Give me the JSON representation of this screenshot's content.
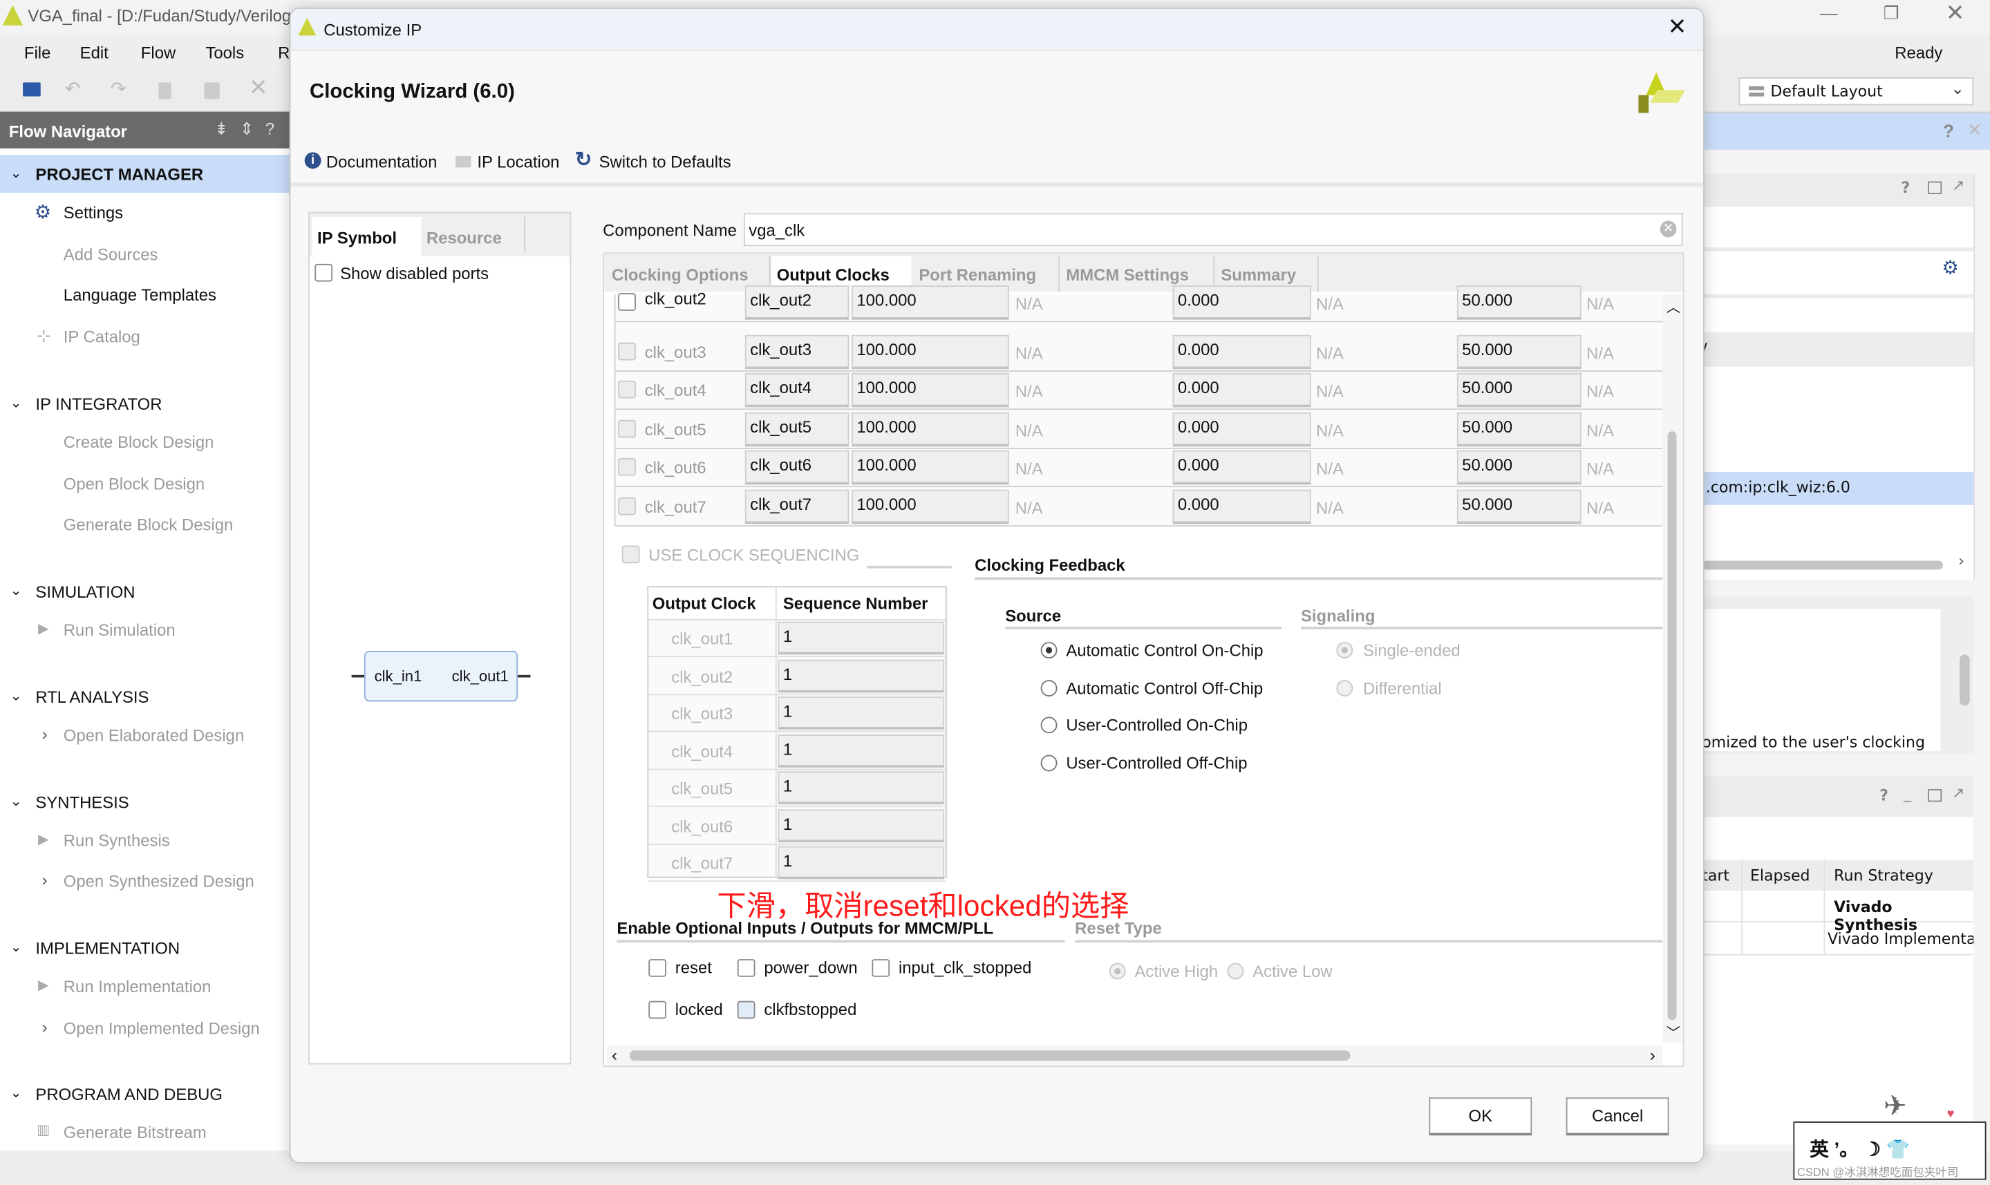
{
  "main_window": {
    "title": "VGA_final - [D:/Fudan/Study/Verilog",
    "menu": [
      "File",
      "Edit",
      "Flow",
      "Tools",
      "R"
    ],
    "status": "Ready",
    "layout_selector": "Default Layout"
  },
  "flow_navigator": {
    "title": "Flow Navigator",
    "sections": [
      {
        "label": "PROJECT MANAGER",
        "items": [
          "Settings",
          "Add Sources",
          "Language Templates",
          "IP Catalog"
        ]
      },
      {
        "label": "IP INTEGRATOR",
        "items": [
          "Create Block Design",
          "Open Block Design",
          "Generate Block Design"
        ]
      },
      {
        "label": "SIMULATION",
        "items": [
          "Run Simulation"
        ]
      },
      {
        "label": "RTL ANALYSIS",
        "items": [
          "Open Elaborated Design"
        ]
      },
      {
        "label": "SYNTHESIS",
        "items": [
          "Run Synthesis",
          "Open Synthesized Design"
        ]
      },
      {
        "label": "IMPLEMENTATION",
        "items": [
          "Run Implementation",
          "Open Implemented Design"
        ]
      },
      {
        "label": "PROGRAM AND DEBUG",
        "items": [
          "Generate Bitstream"
        ]
      }
    ]
  },
  "right_panels": {
    "slash_text": "/",
    "selected_row": ".com:ip:clk_wiz:6.0",
    "description": "omized to the user's clocking",
    "runs_columns": [
      "tart",
      "Elapsed",
      "Run Strategy"
    ],
    "runs_rows": [
      "Vivado Synthesis",
      "Vivado Implementa"
    ]
  },
  "dialog": {
    "title": "Customize IP",
    "heading": "Clocking Wizard (6.0)",
    "toolbar": {
      "documentation": "Documentation",
      "ip_location": "IP Location",
      "switch_defaults": "Switch to Defaults"
    },
    "left_tabs": [
      "IP Symbol",
      "Resource"
    ],
    "show_disabled_ports": "Show disabled ports",
    "symbol": {
      "input": "clk_in1",
      "output": "clk_out1"
    },
    "component_name_label": "Component Name",
    "component_name": "vga_clk",
    "tabs": [
      "Clocking Options",
      "Output Clocks",
      "Port Renaming",
      "MMCM Settings",
      "Summary"
    ],
    "active_tab": "Output Clocks",
    "output_clocks": [
      {
        "clock": "clk_out2",
        "port": "clk_out2",
        "freq": "100.000",
        "freq_actual": "N/A",
        "phase": "0.000",
        "phase_actual": "N/A",
        "duty": "50.000",
        "duty_actual": "N/A",
        "enabled": true
      },
      {
        "clock": "clk_out3",
        "port": "clk_out3",
        "freq": "100.000",
        "freq_actual": "N/A",
        "phase": "0.000",
        "phase_actual": "N/A",
        "duty": "50.000",
        "duty_actual": "N/A",
        "enabled": false
      },
      {
        "clock": "clk_out4",
        "port": "clk_out4",
        "freq": "100.000",
        "freq_actual": "N/A",
        "phase": "0.000",
        "phase_actual": "N/A",
        "duty": "50.000",
        "duty_actual": "N/A",
        "enabled": false
      },
      {
        "clock": "clk_out5",
        "port": "clk_out5",
        "freq": "100.000",
        "freq_actual": "N/A",
        "phase": "0.000",
        "phase_actual": "N/A",
        "duty": "50.000",
        "duty_actual": "N/A",
        "enabled": false
      },
      {
        "clock": "clk_out6",
        "port": "clk_out6",
        "freq": "100.000",
        "freq_actual": "N/A",
        "phase": "0.000",
        "phase_actual": "N/A",
        "duty": "50.000",
        "duty_actual": "N/A",
        "enabled": false
      },
      {
        "clock": "clk_out7",
        "port": "clk_out7",
        "freq": "100.000",
        "freq_actual": "N/A",
        "phase": "0.000",
        "phase_actual": "N/A",
        "duty": "50.000",
        "duty_actual": "N/A",
        "enabled": false
      }
    ],
    "use_clock_sequencing": "USE CLOCK SEQUENCING",
    "sequence_table": {
      "columns": [
        "Output Clock",
        "Sequence Number"
      ],
      "rows": [
        {
          "clock": "clk_out1",
          "seq": "1"
        },
        {
          "clock": "clk_out2",
          "seq": "1"
        },
        {
          "clock": "clk_out3",
          "seq": "1"
        },
        {
          "clock": "clk_out4",
          "seq": "1"
        },
        {
          "clock": "clk_out5",
          "seq": "1"
        },
        {
          "clock": "clk_out6",
          "seq": "1"
        },
        {
          "clock": "clk_out7",
          "seq": "1"
        }
      ]
    },
    "clocking_feedback": {
      "title": "Clocking Feedback",
      "source_label": "Source",
      "sources": [
        "Automatic Control On-Chip",
        "Automatic Control Off-Chip",
        "User-Controlled On-Chip",
        "User-Controlled Off-Chip"
      ],
      "selected_source": "Automatic Control On-Chip",
      "signaling_label": "Signaling",
      "signaling": [
        "Single-ended",
        "Differential"
      ],
      "selected_signaling": "Single-ended"
    },
    "annotation": "下滑，取消reset和locked的选择",
    "optional_ports": {
      "title": "Enable Optional Inputs / Outputs for MMCM/PLL",
      "items": [
        {
          "label": "reset",
          "checked": false
        },
        {
          "label": "power_down",
          "checked": false
        },
        {
          "label": "input_clk_stopped",
          "checked": false
        },
        {
          "label": "locked",
          "checked": false
        },
        {
          "label": "clkfbstopped",
          "checked": false
        }
      ]
    },
    "reset_type": {
      "title": "Reset Type",
      "options": [
        "Active High",
        "Active Low"
      ],
      "selected": "Active High"
    },
    "ok": "OK",
    "cancel": "Cancel"
  },
  "watermark": {
    "ime": "英 ’。 ☽ 👕",
    "text": "CSDN @冰淇淋想吃面包夹叶司"
  },
  "colors": {
    "accent_blue": "#c9dcf8",
    "header_gray": "#6b6b6b",
    "annotation_red": "#ff1a1a",
    "xilinx_yellow": "#d4dc3a"
  }
}
